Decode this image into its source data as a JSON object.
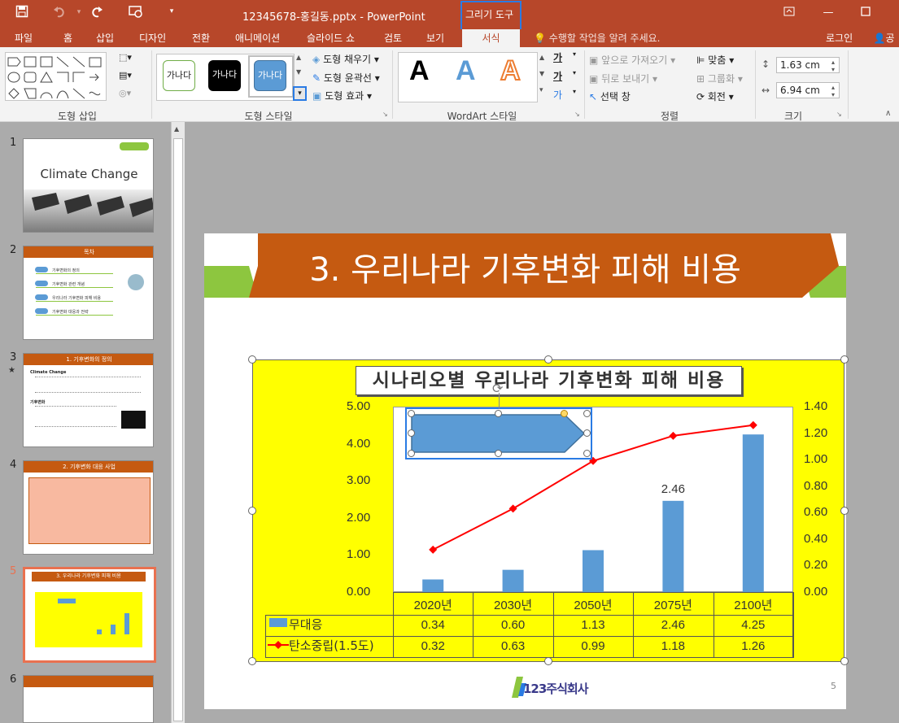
{
  "titlebar": {
    "title": "12345678-홍길동.pptx - PowerPoint",
    "context_group": "그리기 도구"
  },
  "tabs": [
    "파일",
    "홈",
    "삽입",
    "디자인",
    "전환",
    "애니메이션",
    "슬라이드 쇼",
    "검토",
    "보기"
  ],
  "active_tab": "서식",
  "tell_me": "수행할 작업을 알려 주세요.",
  "login": "로그인",
  "share": "공유",
  "groups": {
    "insert_shapes": "도형 삽입",
    "shape_styles": "도형 스타일",
    "wordart": "WordArt 스타일",
    "arrange": "정렬",
    "size": "크기"
  },
  "shape_style_preset_text": "가나다",
  "shape_fill": "도형 채우기",
  "shape_outline": "도형 윤곽선",
  "shape_effects": "도형 효과",
  "wordart_letter": "A",
  "text_fill_glyph": "가",
  "text_outline_glyph": "가",
  "text_effects_glyph": "가",
  "arrange": {
    "bring_forward": "앞으로 가져오기",
    "send_backward": "뒤로 보내기",
    "selection_pane": "선택 창",
    "align": "맞춤",
    "group": "그룹화",
    "rotate": "회전"
  },
  "size": {
    "height": "1.63 cm",
    "width": "6.94 cm"
  },
  "slides": [
    {
      "num": "1",
      "title": "Climate Change"
    },
    {
      "num": "2",
      "title": "목차",
      "items": [
        "기후변화의 정의",
        "기후변화 관련 개념",
        "우리나라 기후변화 피해 비용",
        "기후변화 대응과 전략"
      ]
    },
    {
      "num": "3",
      "title": "1. 기후변화의 정의",
      "bullet1": "Climate Change",
      "bullet2": "기후변화"
    },
    {
      "num": "4",
      "title": "2. 기후변화 대응 사업"
    },
    {
      "num": "5",
      "title": "3. 우리나라 기후변화 피해 비용"
    },
    {
      "num": "6",
      "title": ""
    }
  ],
  "slide_star": "★",
  "current_slide": {
    "title": "3. 우리나라 기후변화 피해 비용",
    "page_number": "5",
    "logo_text": "123주식회사"
  },
  "chart_data": {
    "type": "bar",
    "title": "시나리오별 우리나라 기후변화 피해 비용",
    "categories": [
      "2020년",
      "2030년",
      "2050년",
      "2075년",
      "2100년"
    ],
    "series": [
      {
        "name": "무대응",
        "type": "bar",
        "axis": "left",
        "color": "#5b9bd5",
        "values": [
          0.34,
          0.6,
          1.13,
          2.46,
          4.25
        ]
      },
      {
        "name": "탄소중립(1.5도)",
        "type": "line",
        "axis": "right",
        "color": "#ff0000",
        "values": [
          0.32,
          0.63,
          0.99,
          1.18,
          1.26
        ]
      }
    ],
    "left_axis": {
      "min": 0,
      "max": 5,
      "ticks": [
        "0.00",
        "1.00",
        "2.00",
        "3.00",
        "4.00",
        "5.00"
      ]
    },
    "right_axis": {
      "min": 0,
      "max": 1.4,
      "ticks": [
        "0.00",
        "0.20",
        "0.40",
        "0.60",
        "0.80",
        "1.00",
        "1.20",
        "1.40"
      ]
    },
    "data_label": "2.46",
    "table": true,
    "background": "#ffff00"
  },
  "colors": {
    "brand": "#b7472a",
    "slide_banner": "#c55a11",
    "banner_green": "#8dc63f",
    "selection": "#2a7be4"
  }
}
